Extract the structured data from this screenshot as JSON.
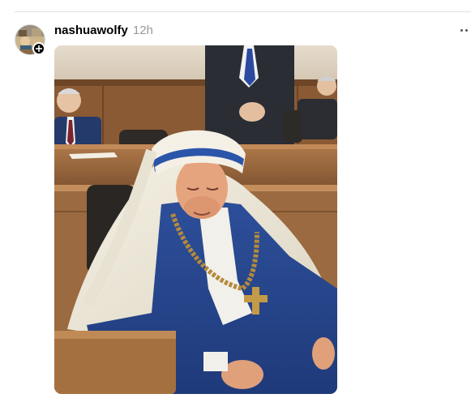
{
  "post": {
    "username": "nashuawolfy",
    "timestamp": "12h",
    "image": {
      "alt_icon": "post-photo"
    }
  },
  "icons": {
    "follow": "plus-icon",
    "more": "more-horizontal-icon"
  },
  "colors": {
    "username": "#000000",
    "timestamp": "#999999",
    "divider": "#e3e3e3",
    "follow_badge": "#000000"
  }
}
